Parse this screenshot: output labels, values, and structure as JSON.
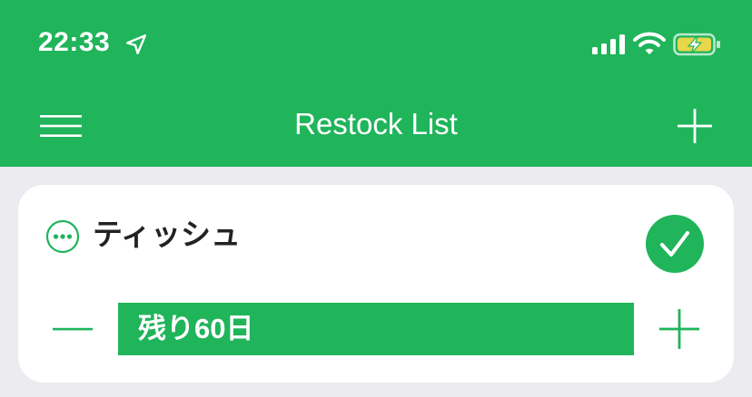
{
  "status_bar": {
    "time": "22:33",
    "icons": [
      "location-arrow-icon",
      "cellular-signal-icon",
      "wifi-icon",
      "battery-charging-icon"
    ]
  },
  "nav": {
    "title": "Restock List",
    "menu_icon": "hamburger-menu-icon",
    "add_icon": "plus-icon"
  },
  "items": [
    {
      "name": "ティッシュ",
      "remaining_label": "残り60日",
      "remaining_fraction": 1.0,
      "checked": true
    }
  ],
  "colors": {
    "accent": "#20b45b",
    "background": "#ebebf0",
    "card": "#ffffff",
    "text": "#222222"
  }
}
